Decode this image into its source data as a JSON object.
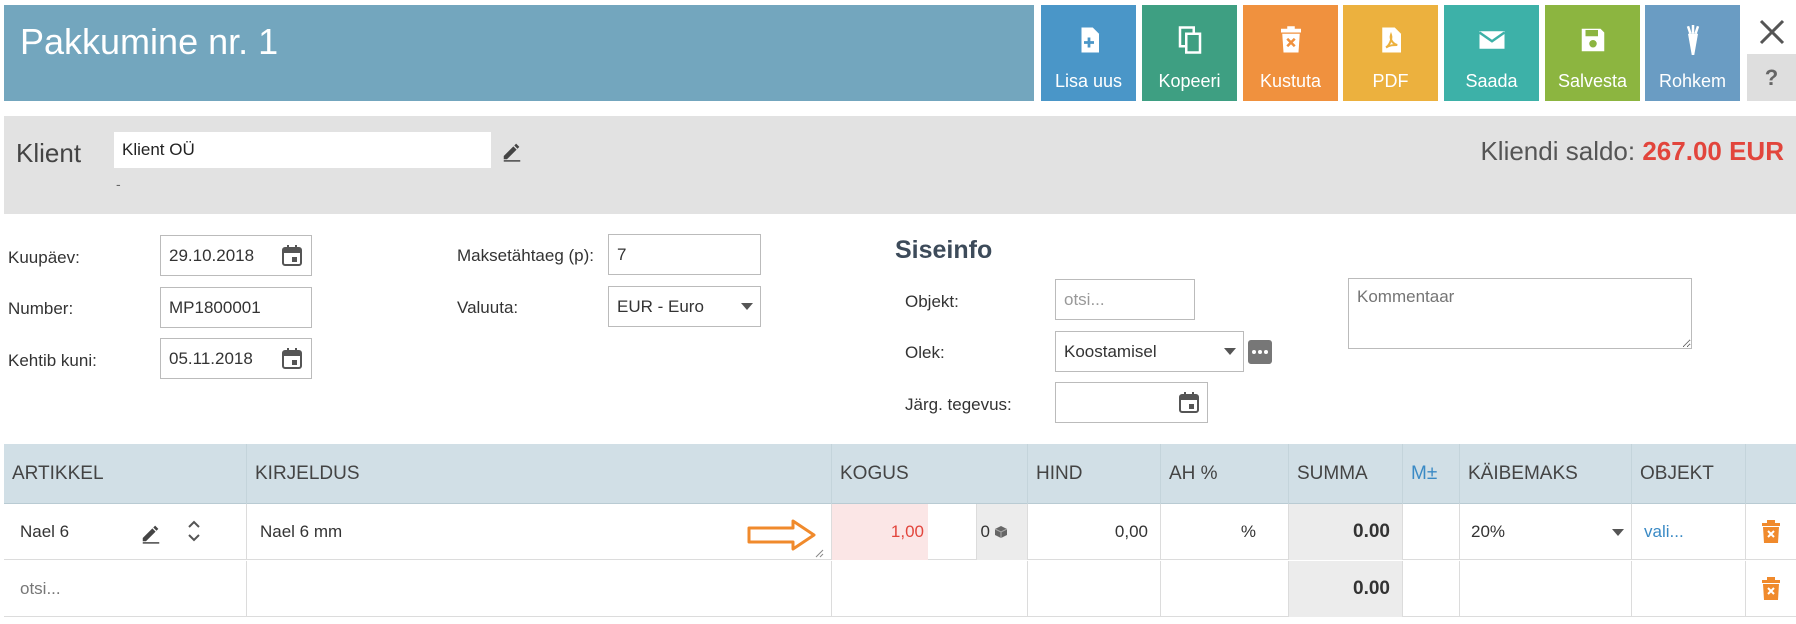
{
  "header": {
    "title": "Pakkumine nr. 1",
    "buttons": {
      "new": "Lisa uus",
      "copy": "Kopeeri",
      "delete": "Kustuta",
      "pdf": "PDF",
      "send": "Saada",
      "save": "Salvesta",
      "more": "Rohkem"
    },
    "help": "?"
  },
  "client": {
    "label": "Klient",
    "value": "Klient OÜ",
    "sub": "-",
    "saldo_label": "Kliendi saldo:",
    "saldo_value": "267.00 EUR"
  },
  "form": {
    "date_label": "Kuupäev:",
    "date_value": "29.10.2018",
    "number_label": "Number:",
    "number_value": "MP1800001",
    "valid_label": "Kehtib kuni:",
    "valid_value": "05.11.2018",
    "due_label": "Maksetähtaeg (p):",
    "due_value": "7",
    "currency_label": "Valuuta:",
    "currency_value": "EUR - Euro"
  },
  "internal": {
    "title": "Siseinfo",
    "object_label": "Objekt:",
    "object_placeholder": "otsi...",
    "status_label": "Olek:",
    "status_value": "Koostamisel",
    "next_label": "Järg. tegevus:",
    "next_value": "",
    "comment_placeholder": "Kommentaar"
  },
  "table": {
    "columns": {
      "article": "ARTIKKEL",
      "description": "KIRJELDUS",
      "quantity": "KOGUS",
      "price": "HIND",
      "discount": "AH %",
      "sum": "SUMMA",
      "mpm": "M±",
      "vat": "KÄIBEMAKS",
      "object": "OBJEKT"
    },
    "rows": [
      {
        "article": "Nael 6",
        "description": "Nael 6 mm",
        "quantity": "1,00",
        "stock": "0",
        "price": "0,00",
        "discount": "%",
        "sum": "0.00",
        "vat": "20%",
        "object": "vali..."
      },
      {
        "article": "otsi...",
        "sum": "0.00"
      }
    ]
  },
  "colors": {
    "title_bar": "#73a6be",
    "saldo": "#e2453c",
    "arrow": "#f08a2c"
  }
}
